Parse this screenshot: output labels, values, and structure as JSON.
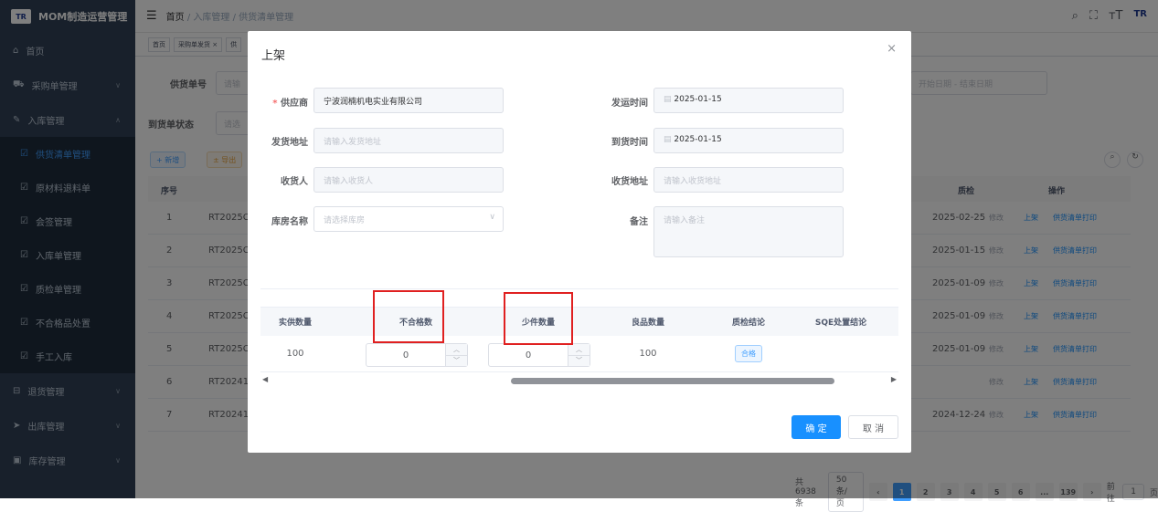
{
  "app": {
    "title": "MOM制造运营管理",
    "logo": "TR"
  },
  "sidebar": {
    "items": [
      {
        "label": "首页",
        "icon": "dashboard-icon"
      },
      {
        "label": "采购单管理",
        "icon": "cart-icon"
      },
      {
        "label": "入库管理",
        "icon": "edit-icon"
      }
    ],
    "sub_items": [
      {
        "label": "供货清单管理"
      },
      {
        "label": "原材料退料单"
      },
      {
        "label": "会签管理"
      },
      {
        "label": "入库单管理"
      },
      {
        "label": "质检单管理"
      },
      {
        "label": "不合格品处置"
      },
      {
        "label": "手工入库"
      }
    ],
    "bottom_items": [
      {
        "label": "退货管理"
      },
      {
        "label": "出库管理"
      },
      {
        "label": "库存管理"
      }
    ]
  },
  "breadcrumb": {
    "home": "首页",
    "sep": "/",
    "level1": "入库管理",
    "level2": "供货清单管理"
  },
  "tags": [
    "首页",
    "采购单发货 ×",
    "供"
  ],
  "filters": {
    "order_no_label": "供货单号",
    "order_no_ph": "请输",
    "arrival_label": "到货单状态",
    "arrival_ph": "请选",
    "date_start": "开始日期",
    "date_sep": "-",
    "date_end": "结束日期"
  },
  "toolbar": {
    "add": "+ 新增",
    "export": "± 导出"
  },
  "table": {
    "col_index": "序号",
    "col_date": "质检",
    "col_ops": "操作",
    "rows": [
      {
        "idx": "1",
        "code": "RT2025C",
        "date": "2025-02-25"
      },
      {
        "idx": "2",
        "code": "RT2025C",
        "date": "2025-01-15"
      },
      {
        "idx": "3",
        "code": "RT2025C",
        "date": "2025-01-09"
      },
      {
        "idx": "4",
        "code": "RT2025C",
        "date": "2025-01-09"
      },
      {
        "idx": "5",
        "code": "RT2025C",
        "date": "2025-01-09"
      },
      {
        "idx": "6",
        "code": "RT20241",
        "date": ""
      },
      {
        "idx": "7",
        "code": "RT20241",
        "date": "2024-12-24"
      }
    ],
    "op_edit": "修改",
    "op_shelve": "上架",
    "op_print": "供货清单打印"
  },
  "pagination": {
    "total": "共 6938 条",
    "size": "50条/页",
    "pages": [
      "1",
      "2",
      "3",
      "4",
      "5",
      "6",
      "...",
      "139"
    ],
    "goto": "前往",
    "goto_val": "1",
    "page_word": "页"
  },
  "dialog": {
    "title": "上架",
    "form": {
      "supplier_label": "供应商",
      "supplier_value": "宁波润楠机电实业有限公司",
      "ship_time_label": "发运时间",
      "ship_time_value": "2025-01-15",
      "ship_addr_label": "发货地址",
      "ship_addr_ph": "请输入发货地址",
      "arrive_time_label": "到货时间",
      "arrive_time_value": "2025-01-15",
      "receiver_label": "收货人",
      "receiver_ph": "请输入收货人",
      "recv_addr_label": "收货地址",
      "recv_addr_ph": "请输入收货地址",
      "warehouse_label": "库房名称",
      "warehouse_ph": "请选择库房",
      "remark_label": "备注",
      "remark_ph": "请输入备注"
    },
    "grid": {
      "headers": [
        "实供数量",
        "不合格数",
        "少件数量",
        "良品数量",
        "质检结论",
        "SQE处置结论"
      ],
      "row": {
        "actual": "100",
        "unqualified": "0",
        "short": "0",
        "good": "100",
        "conclusion": "合格",
        "sqe": ""
      }
    },
    "confirm": "确 定",
    "cancel": "取 消"
  }
}
